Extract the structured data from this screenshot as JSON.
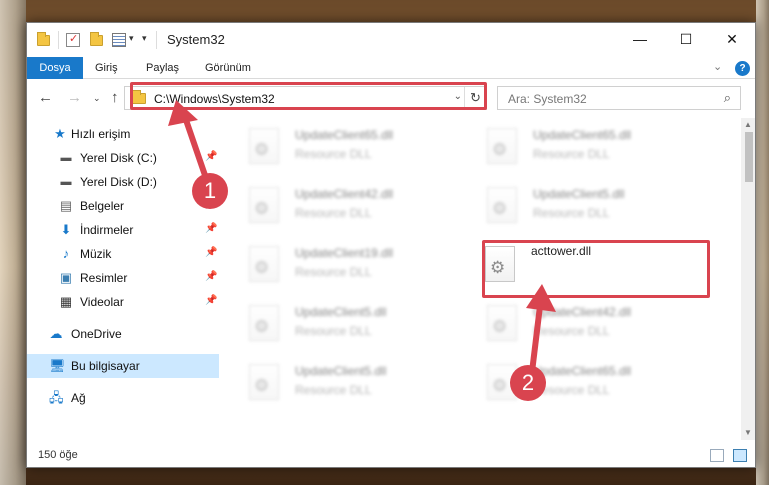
{
  "window": {
    "title": "System32",
    "ribbon_tabs": [
      "Dosya",
      "Giriş",
      "Paylaş",
      "Görünüm"
    ],
    "help_label": "?"
  },
  "address": {
    "path": "C:\\Windows\\System32",
    "search_placeholder": "Ara: System32"
  },
  "sidebar": {
    "items": [
      {
        "label": "Hızlı erişim",
        "icon": "star-icon"
      },
      {
        "label": "Yerel Disk (C:)",
        "icon": "drive-icon"
      },
      {
        "label": "Yerel Disk (D:)",
        "icon": "drive-icon"
      },
      {
        "label": "Belgeler",
        "icon": "document-icon"
      },
      {
        "label": "İndirmeler",
        "icon": "download-icon"
      },
      {
        "label": "Müzik",
        "icon": "music-icon"
      },
      {
        "label": "Resimler",
        "icon": "picture-icon"
      },
      {
        "label": "Videolar",
        "icon": "video-icon"
      },
      {
        "label": "OneDrive",
        "icon": "cloud-icon"
      },
      {
        "label": "Bu bilgisayar",
        "icon": "computer-icon"
      },
      {
        "label": "Ağ",
        "icon": "network-icon"
      }
    ]
  },
  "files": [
    {
      "name": "UpdateClient65.dll",
      "desc": "Resource DLL"
    },
    {
      "name": "UpdateClient65.dll",
      "desc": "Resource DLL"
    },
    {
      "name": "UpdateClient42.dll",
      "desc": "Resource DLL"
    },
    {
      "name": "UpdateClient5.dll",
      "desc": "Resource DLL"
    },
    {
      "name": "UpdateClient19.dll",
      "desc": "Resource DLL"
    },
    {
      "name": "acttower.dll",
      "desc": ""
    },
    {
      "name": "UpdateClient5.dll",
      "desc": "Resource DLL"
    },
    {
      "name": "UpdateClient42.dll",
      "desc": "Resource DLL"
    },
    {
      "name": "UpdateClient5.dll",
      "desc": "Resource DLL"
    },
    {
      "name": "UpdateClient65.dll",
      "desc": "Resource DLL"
    }
  ],
  "status": {
    "item_count": "150 öğe"
  },
  "annotations": {
    "step1": "1",
    "step2": "2",
    "color": "#d9444f"
  },
  "colors": {
    "accent": "#1979ca",
    "selected": "#cce8ff"
  }
}
